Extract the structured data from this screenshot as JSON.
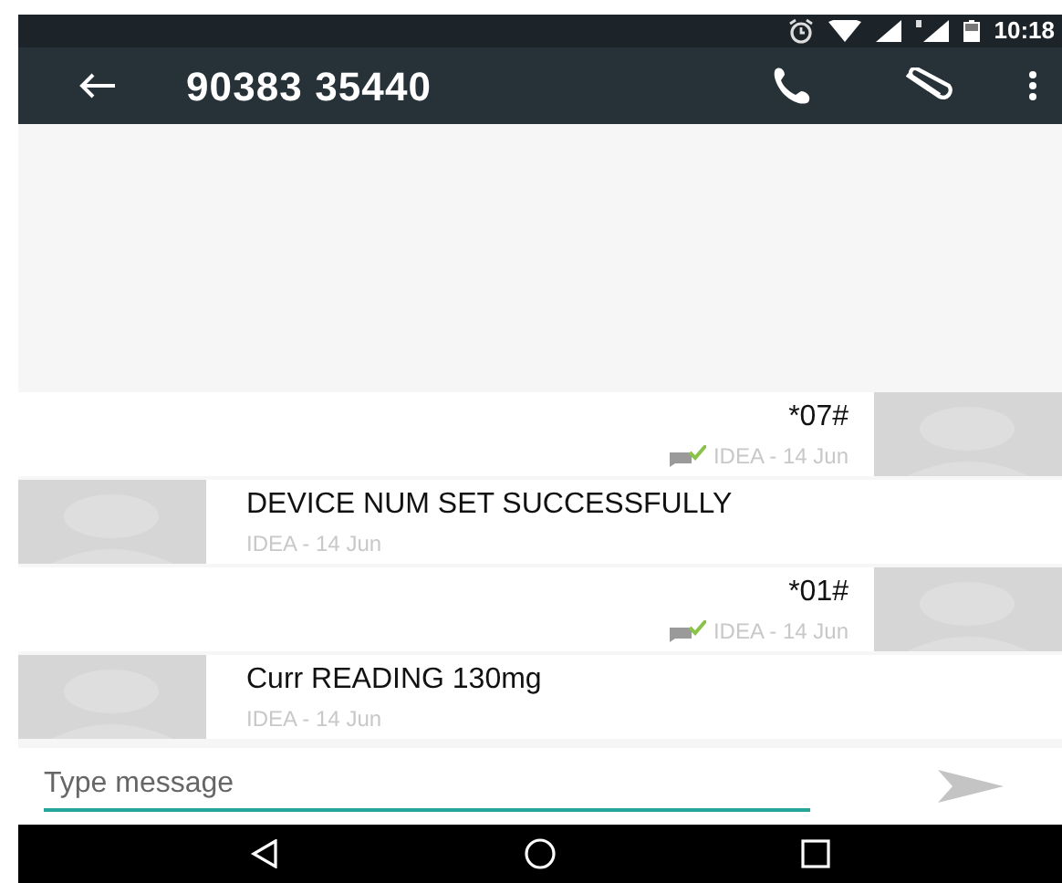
{
  "status_bar": {
    "time": "10:18"
  },
  "toolbar": {
    "title": "90383 35440"
  },
  "messages": [
    {
      "kind": "sent",
      "text": "*07#",
      "meta": "IDEA - 14 Jun",
      "delivered": true
    },
    {
      "kind": "received",
      "text": "DEVICE NUM SET SUCCESSFULLY",
      "meta": "IDEA - 14 Jun"
    },
    {
      "kind": "sent",
      "text": "*01#",
      "meta": "IDEA - 14 Jun",
      "delivered": true
    },
    {
      "kind": "received",
      "text": "Curr READING 130mg",
      "meta": "IDEA - 14 Jun"
    }
  ],
  "composer": {
    "placeholder": "Type message"
  }
}
